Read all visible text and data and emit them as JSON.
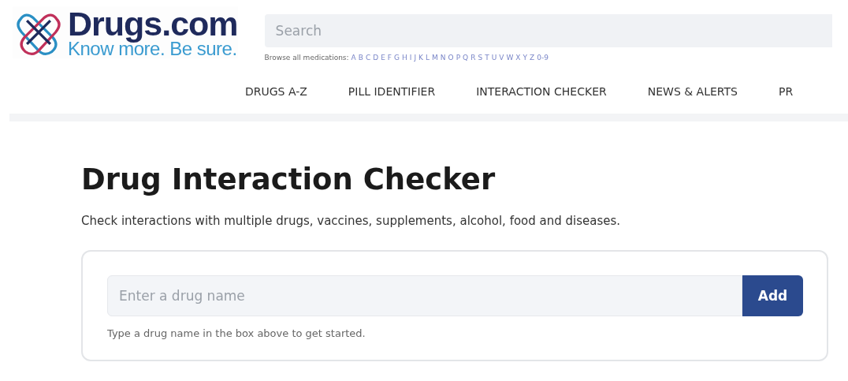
{
  "logo": {
    "name": "Drugs.com",
    "tagline": "Know more. Be sure."
  },
  "search": {
    "placeholder": "Search"
  },
  "browse": {
    "label": "Browse all medications:",
    "letters": [
      "A",
      "B",
      "C",
      "D",
      "E",
      "F",
      "G",
      "H",
      "I",
      "J",
      "K",
      "L",
      "M",
      "N",
      "O",
      "P",
      "Q",
      "R",
      "S",
      "T",
      "U",
      "V",
      "W",
      "X",
      "Y",
      "Z",
      "0-9"
    ]
  },
  "nav": [
    "DRUGS A-Z",
    "PILL IDENTIFIER",
    "INTERACTION CHECKER",
    "NEWS & ALERTS",
    "PR"
  ],
  "heading": "Drug Interaction Checker",
  "subtitle": "Check interactions with multiple drugs, vaccines, supplements, alcohol, food and diseases.",
  "checker": {
    "placeholder": "Enter a drug name",
    "button": "Add",
    "help": "Type a drug name in the box above to get started."
  }
}
